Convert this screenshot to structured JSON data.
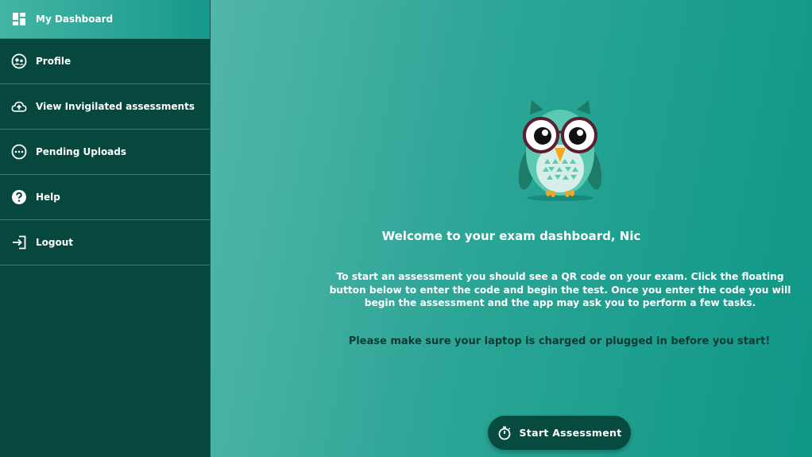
{
  "sidebar": {
    "items": [
      {
        "label": "My Dashboard",
        "icon": "dashboard-icon",
        "active": true
      },
      {
        "label": "Profile",
        "icon": "profile-icon"
      },
      {
        "label": "View Invigilated assessments",
        "icon": "cloud-upload-icon"
      },
      {
        "label": "Pending Uploads",
        "icon": "more-horizontal-icon"
      },
      {
        "label": "Help",
        "icon": "help-icon"
      },
      {
        "label": "Logout",
        "icon": "logout-icon"
      }
    ]
  },
  "main": {
    "welcome": "Welcome to your exam dashboard, Nic",
    "instructions": "To start an assessment you should see a QR code on your exam. Click the floating button below to enter the code and begin the test. Once you enter the code you will begin the assessment and the app may ask you to perform a few tasks.",
    "warning": "Please make sure your laptop is charged or plugged in before you start!",
    "start_button": "Start Assessment",
    "start_icon": "stopwatch-icon"
  },
  "colors": {
    "sidebar_bg": "#06483d",
    "active_item": "#43b5a5",
    "main_bg": "#2ba596",
    "button_bg": "#074a3f",
    "warning_text": "#0d3a33"
  }
}
